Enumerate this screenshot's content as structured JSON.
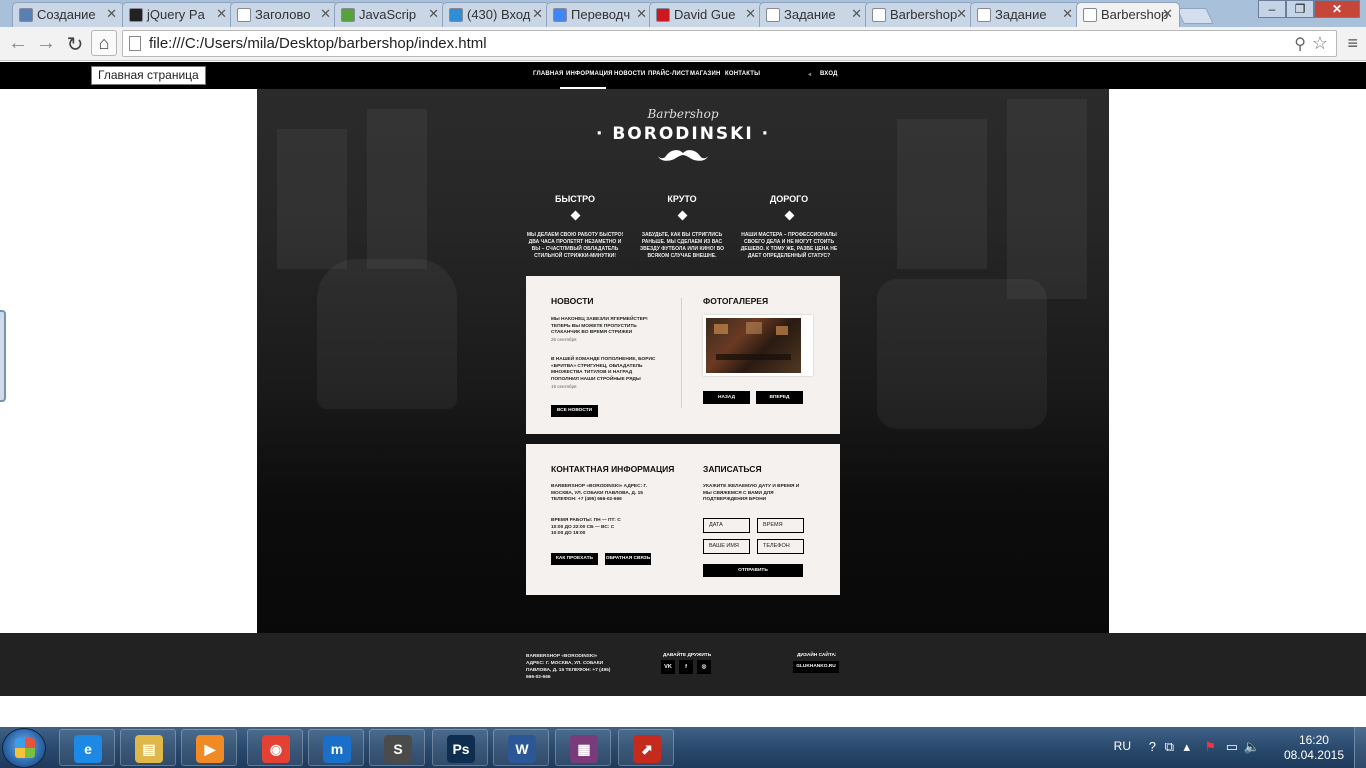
{
  "browser": {
    "tabs": [
      {
        "title": "Создание",
        "icon": "html-icon",
        "color": "#5a7fb5",
        "active": false
      },
      {
        "title": "jQuery Pa",
        "icon": "github-icon",
        "color": "#222222",
        "active": false
      },
      {
        "title": "Заголово",
        "icon": "page-icon",
        "color": "#ffffff",
        "active": false
      },
      {
        "title": "JavaScrip",
        "icon": "code-icon",
        "color": "#54a33b",
        "active": false
      },
      {
        "title": "(430) Вход",
        "icon": "mail-icon",
        "color": "#2f8fd5",
        "active": false
      },
      {
        "title": "Переводч",
        "icon": "translate-icon",
        "color": "#4285f4",
        "active": false
      },
      {
        "title": "David Gue",
        "icon": "youtube-icon",
        "color": "#cc181e",
        "active": false
      },
      {
        "title": "Задание",
        "icon": "page-icon",
        "color": "#ffffff",
        "active": false
      },
      {
        "title": "Barbershop",
        "icon": "page-icon",
        "color": "#ffffff",
        "active": false
      },
      {
        "title": "Задание",
        "icon": "page-icon",
        "color": "#ffffff",
        "active": false
      },
      {
        "title": "Barbershop",
        "icon": "page-icon",
        "color": "#ffffff",
        "active": true
      }
    ],
    "url": "file:///C:/Users/mila/Desktop/barbershop/index.html",
    "tooltip": "Главная страница"
  },
  "site": {
    "nav": {
      "items": [
        "ГЛАВНАЯ",
        "ИНФОРМАЦИЯ",
        "НОВОСТИ",
        "ПРАЙС-ЛИСТ",
        "МАГАЗИН",
        "КОНТАКТЫ"
      ],
      "login": "ВХОД",
      "active_index": 1
    },
    "logo": {
      "script": "Barbershop",
      "main": "· BORODINSKI ·"
    },
    "features": [
      {
        "title": "БЫСТРО",
        "text": "МЫ ДЕЛАЕМ СВОЮ РАБОТУ БЫСТРО! ДВА ЧАСА ПРОЛЕТЯТ НЕЗАМЕТНО И ВЫ – СЧАСТЛИВЫЙ ОБЛАДАТЕЛЬ СТИЛЬНОЙ СТРИЖКИ-МИНУТКИ!"
      },
      {
        "title": "КРУТО",
        "text": "ЗАБУДЬТЕ, КАК ВЫ СТРИГЛИСЬ РАНЬШЕ. МЫ СДЕЛАЕМ ИЗ ВАС ЗВЕЗДУ ФУТБОЛА ИЛИ КИНО! ВО ВСЯКОМ СЛУЧАЕ ВНЕШНЕ."
      },
      {
        "title": "ДОРОГО",
        "text": "НАШИ МАСТЕРА – ПРОФЕССИОНАЛЫ СВОЕГО ДЕЛА И НЕ МОГУТ СТОИТЬ ДЕШЕВО. К ТОМУ ЖЕ, РАЗВЕ ЦЕНА НЕ ДАЕТ ОПРЕДЕЛЕННЫЙ СТАТУС?"
      }
    ],
    "news": {
      "title": "НОВОСТИ",
      "items": [
        {
          "text": "МЫ НАКОНЕЦ ЗАВЕЗЛИ ЯГЕРМЕЙСТЕР! ТЕПЕРЬ ВЫ МОЖЕТЕ ПРОПУСТИТЬ СТАКАНЧИК ВО ВРЕМЯ СТРИЖКИ",
          "date": "25 сентября"
        },
        {
          "text": "В НАШЕЙ КОМАНДЕ ПОПОЛНЕНИЕ, БОРИС «БРИТВА» СТРИГУНЕЦ, ОБЛАДАТЕЛЬ МНОЖЕСТВА ТИТУЛОВ И НАГРАД ПОПОЛНИЛ НАШИ СТРОЙНЫЕ РЯДЫ",
          "date": "19 сентября"
        }
      ],
      "all_button": "ВСЕ НОВОСТИ"
    },
    "gallery": {
      "title": "ФОТОГАЛЕРЕЯ",
      "prev": "НАЗАД",
      "next": "ВПЕРЕД"
    },
    "contacts": {
      "title": "КОНТАКТНАЯ ИНФОРМАЦИЯ",
      "address": "BARBERSHOP «BORODINSKI» АДРЕС: Г. МОСКВА, УЛ. СОБАКИ ПАВЛОВА, Д. 15 ТЕЛЕФОН: +7 (495) 666-02-666",
      "hours": "ВРЕМЯ РАБОТЫ: ПН — ПТ: С 10:00 ДО 22:00 СБ — ВС: С 10:00 ДО 19:00",
      "route_button": "КАК ПРОЕХАТЬ",
      "feedback_button": "ОБРАТНАЯ СВЯЗЬ"
    },
    "booking": {
      "title": "ЗАПИСАТЬСЯ",
      "text": "УКАЖИТЕ ЖЕЛАЕМУЮ ДАТУ И ВРЕМЯ И МЫ СВЯЖЕМСЯ С ВАМИ ДЛЯ ПОДТВЕРЖДЕНИЯ БРОНИ",
      "date_placeholder": "ДАТА",
      "time_placeholder": "ВРЕМЯ",
      "name_placeholder": "ВАШЕ ИМЯ",
      "phone_placeholder": "ТЕЛЕФОН",
      "submit": "ОТПРАВИТЬ"
    },
    "footer": {
      "info": "BARBERSHOP «BORODINSKI» АДРЕС: Г. МОСКВА, УЛ. СОБАКИ ПАВЛОВА, Д. 15 ТЕЛЕФОН: +7 (495) 666-02-666",
      "social_title": "ДАВАЙТЕ ДРУЖИТЬ",
      "social": [
        "VK",
        "f",
        "◎"
      ],
      "design_title": "ДИЗАЙН САЙТА:",
      "design_link": "GLUKHANKO.RU"
    }
  },
  "taskbar": {
    "apps": [
      {
        "name": "ie",
        "label": "e",
        "color": "#1e88e5"
      },
      {
        "name": "explorer",
        "label": "▤",
        "color": "#e0b84a"
      },
      {
        "name": "media-player",
        "label": "▶",
        "color": "#f08a24"
      },
      {
        "name": "chrome",
        "label": "◉",
        "color": "#e34133"
      },
      {
        "name": "maxthon",
        "label": "m",
        "color": "#1a6fc9"
      },
      {
        "name": "sublime",
        "label": "S",
        "color": "#4b4b4b"
      },
      {
        "name": "photoshop",
        "label": "Ps",
        "color": "#0e2d4f"
      },
      {
        "name": "word",
        "label": "W",
        "color": "#2b5797"
      },
      {
        "name": "winrar",
        "label": "▦",
        "color": "#7a3b7a"
      },
      {
        "name": "presentation",
        "label": "⬈",
        "color": "#c42b1c"
      }
    ],
    "lang": "RU",
    "time": "16:20",
    "date": "08.04.2015"
  }
}
